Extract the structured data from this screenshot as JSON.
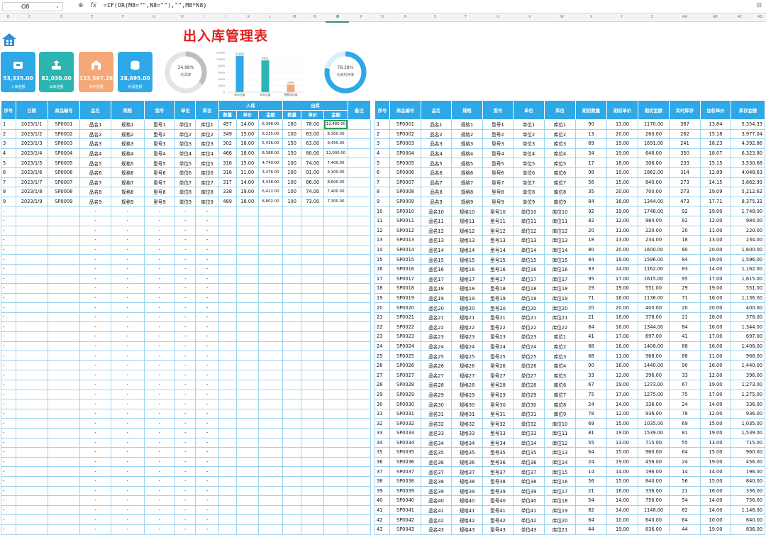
{
  "formula_bar": {
    "cell_ref": "O8",
    "formula": "=IF(OR(M8=\"\",N8=\"\"),\"\",M8*N8)",
    "fx_label": "fx"
  },
  "column_letters": [
    "B",
    "C",
    "D",
    "E",
    "F",
    "G",
    "H",
    "I",
    "J",
    "K",
    "L",
    "M",
    "N",
    "O",
    "P",
    "Q",
    "R",
    "S",
    "T",
    "U",
    "V",
    "W",
    "X",
    "Y",
    "Z",
    "AA",
    "AB",
    "AC",
    "AD"
  ],
  "selected_column": "O",
  "dashboard": {
    "title": "出入库管理表",
    "cards": [
      {
        "value": "53,335.00",
        "label": "入库金额",
        "color": "#2ea8e6",
        "icon": "inbox-icon"
      },
      {
        "value": "82,030.00",
        "label": "出库金额",
        "color": "#2bb5b0",
        "icon": "outbox-icon"
      },
      {
        "value": "133,597.26",
        "label": "库存金额",
        "color": "#f4a877",
        "icon": "warehouse-icon"
      },
      {
        "value": "28,695.00",
        "label": "利润金额",
        "color": "#2ea8e6",
        "icon": "coins-icon"
      }
    ],
    "donuts": [
      {
        "value": "34.98%",
        "label": "利润率",
        "fraction": 0.3498,
        "color": "#bdbdbd"
      },
      {
        "value": "78.28%",
        "label": "仓库利用率",
        "fraction": 0.7828,
        "color": "#2ea8e6"
      }
    ]
  },
  "chart_data": {
    "type": "bar",
    "categories": [
      "库存总量",
      "库存总量",
      "预警库存量"
    ],
    "values": [
      11000,
      9611,
      2309
    ],
    "data_labels": [
      "11000",
      "9611",
      "2309"
    ],
    "colors": [
      "#2ea8e6",
      "#2bb5b0",
      "#f4a877"
    ],
    "ylim": [
      0,
      12000
    ],
    "yticks": [
      "12000",
      "10000",
      "8000",
      "6000",
      "4000",
      "2000",
      "0"
    ]
  },
  "left_table": {
    "headers_top": [
      "序号",
      "日期",
      "商品编号",
      "品名",
      "规格",
      "型号",
      "单位",
      "库位",
      "入库",
      "出库",
      "备注"
    ],
    "headers_sub": [
      "数量",
      "单价",
      "金额",
      "数量",
      "单价",
      "金额"
    ],
    "rows": [
      [
        "1",
        "2023/1/1",
        "SP0001",
        "品名1",
        "规格1",
        "型号1",
        "单位1",
        "库位1",
        "457",
        "14.00",
        "6,398.00",
        "160",
        "78.00",
        "12,480.00",
        ""
      ],
      [
        "2",
        "2023/1/2",
        "SP0002",
        "品名2",
        "规格2",
        "型号2",
        "单位2",
        "库位2",
        "349",
        "15.00",
        "6,235.00",
        "100",
        "83.00",
        "8,300.00",
        ""
      ],
      [
        "3",
        "2023/1/3",
        "SP0003",
        "品名3",
        "规格3",
        "型号3",
        "单位3",
        "库位3",
        "302",
        "18.00",
        "5,436.00",
        "150",
        "63.00",
        "9,450.00",
        ""
      ],
      [
        "4",
        "2023/1/4",
        "SP0004",
        "品名4",
        "规格4",
        "型号4",
        "单位4",
        "库位4",
        "466",
        "18.00",
        "8,388.00",
        "150",
        "80.00",
        "12,000.00",
        ""
      ],
      [
        "5",
        "2023/1/5",
        "SP0005",
        "品名5",
        "规格5",
        "型号5",
        "单位5",
        "库位5",
        "316",
        "15.00",
        "4,740.00",
        "100",
        "74.00",
        "7,400.00",
        ""
      ],
      [
        "6",
        "2023/1/6",
        "SP0006",
        "品名6",
        "规格6",
        "型号6",
        "单位6",
        "库位6",
        "316",
        "11.00",
        "3,476.00",
        "100",
        "91.00",
        "9,100.00",
        ""
      ],
      [
        "7",
        "2023/1/7",
        "SP0007",
        "品名7",
        "规格7",
        "型号7",
        "单位7",
        "库位7",
        "317",
        "14.00",
        "4,438.00",
        "100",
        "86.00",
        "8,600.00",
        ""
      ],
      [
        "8",
        "2023/1/8",
        "SP0008",
        "品名8",
        "规格8",
        "型号8",
        "单位8",
        "库位8",
        "338",
        "19.00",
        "6,422.00",
        "100",
        "74.00",
        "7,400.00",
        ""
      ],
      [
        "9",
        "2023/1/9",
        "SP0009",
        "品名9",
        "规格9",
        "型号9",
        "单位9",
        "库位9",
        "489",
        "18.00",
        "8,802.00",
        "100",
        "73.00",
        "7,300.00",
        ""
      ]
    ],
    "empty_cell": "-"
  },
  "right_table": {
    "headers": [
      "序号",
      "商品编号",
      "品名",
      "规格",
      "型号",
      "单位",
      "库位",
      "期初数量",
      "期初单价",
      "期初金额",
      "实时库存",
      "加权单价",
      "库存金额"
    ],
    "rows": [
      [
        "1",
        "SP0001",
        "品名1",
        "规格1",
        "型号1",
        "单位1",
        "库位1",
        "90",
        "13.00",
        "1170.00",
        "387",
        "13.84",
        "5,354.33"
      ],
      [
        "2",
        "SP0002",
        "品名2",
        "规格2",
        "型号2",
        "单位2",
        "库位2",
        "13",
        "20.00",
        "260.00",
        "262",
        "15.18",
        "3,977.04"
      ],
      [
        "3",
        "SP0003",
        "品名3",
        "规格3",
        "型号3",
        "单位3",
        "库位3",
        "89",
        "19.00",
        "1691.00",
        "241",
        "18.23",
        "4,392.86"
      ],
      [
        "4",
        "SP0004",
        "品名4",
        "规格4",
        "型号4",
        "单位4",
        "库位4",
        "34",
        "19.00",
        "646.00",
        "350",
        "18.07",
        "6,323.80"
      ],
      [
        "5",
        "SP0005",
        "品名5",
        "规格5",
        "型号5",
        "单位5",
        "库位5",
        "17",
        "18.00",
        "306.00",
        "233",
        "15.15",
        "3,530.68"
      ],
      [
        "6",
        "SP0006",
        "品名6",
        "规格6",
        "型号6",
        "单位6",
        "库位6",
        "98",
        "19.00",
        "1862.00",
        "314",
        "12.89",
        "4,048.63"
      ],
      [
        "7",
        "SP0007",
        "品名7",
        "规格7",
        "型号7",
        "单位7",
        "库位7",
        "56",
        "15.00",
        "840.00",
        "273",
        "14.15",
        "3,862.99"
      ],
      [
        "8",
        "SP0008",
        "品名8",
        "规格8",
        "型号8",
        "单位8",
        "库位8",
        "35",
        "20.00",
        "700.00",
        "273",
        "19.09",
        "5,212.62"
      ],
      [
        "9",
        "SP0009",
        "品名9",
        "规格9",
        "型号9",
        "单位9",
        "库位9",
        "84",
        "16.00",
        "1344.00",
        "473",
        "17.71",
        "8,375.32"
      ],
      [
        "10",
        "SP0010",
        "品名10",
        "规格10",
        "型号10",
        "单位10",
        "库位10",
        "92",
        "19.00",
        "1748.00",
        "92",
        "19.00",
        "1,748.00"
      ],
      [
        "11",
        "SP0011",
        "品名11",
        "规格11",
        "型号11",
        "单位11",
        "库位11",
        "82",
        "12.00",
        "984.00",
        "82",
        "12.00",
        "984.00"
      ],
      [
        "12",
        "SP0012",
        "品名12",
        "规格12",
        "型号12",
        "单位12",
        "库位12",
        "20",
        "11.00",
        "220.00",
        "20",
        "11.00",
        "220.00"
      ],
      [
        "13",
        "SP0013",
        "品名13",
        "规格13",
        "型号13",
        "单位13",
        "库位13",
        "18",
        "13.00",
        "234.00",
        "18",
        "13.00",
        "234.00"
      ],
      [
        "14",
        "SP0014",
        "品名14",
        "规格14",
        "型号14",
        "单位14",
        "库位14",
        "80",
        "20.00",
        "1600.00",
        "80",
        "20.00",
        "1,600.00"
      ],
      [
        "15",
        "SP0015",
        "品名15",
        "规格15",
        "型号15",
        "单位15",
        "库位15",
        "84",
        "19.00",
        "1596.00",
        "84",
        "19.00",
        "1,596.00"
      ],
      [
        "16",
        "SP0016",
        "品名16",
        "规格16",
        "型号16",
        "单位16",
        "库位16",
        "83",
        "14.00",
        "1162.00",
        "83",
        "14.00",
        "1,162.00"
      ],
      [
        "17",
        "SP0017",
        "品名17",
        "规格17",
        "型号17",
        "单位17",
        "库位17",
        "95",
        "17.00",
        "1615.00",
        "95",
        "17.00",
        "1,615.00"
      ],
      [
        "18",
        "SP0018",
        "品名18",
        "规格18",
        "型号18",
        "单位18",
        "库位18",
        "29",
        "19.00",
        "551.00",
        "29",
        "19.00",
        "551.00"
      ],
      [
        "19",
        "SP0019",
        "品名19",
        "规格19",
        "型号19",
        "单位19",
        "库位19",
        "71",
        "16.00",
        "1136.00",
        "71",
        "16.00",
        "1,136.00"
      ],
      [
        "20",
        "SP0020",
        "品名20",
        "规格20",
        "型号20",
        "单位20",
        "库位20",
        "20",
        "20.00",
        "400.00",
        "20",
        "20.00",
        "400.00"
      ],
      [
        "21",
        "SP0021",
        "品名21",
        "规格21",
        "型号21",
        "单位21",
        "库位21",
        "21",
        "18.00",
        "378.00",
        "21",
        "18.00",
        "378.00"
      ],
      [
        "22",
        "SP0022",
        "品名22",
        "规格22",
        "型号22",
        "单位22",
        "库位22",
        "84",
        "16.00",
        "1344.00",
        "84",
        "16.00",
        "1,344.00"
      ],
      [
        "23",
        "SP0023",
        "品名23",
        "规格23",
        "型号23",
        "单位23",
        "库位1",
        "41",
        "17.00",
        "697.00",
        "41",
        "17.00",
        "697.00"
      ],
      [
        "24",
        "SP0024",
        "品名24",
        "规格24",
        "型号24",
        "单位24",
        "库位2",
        "88",
        "16.00",
        "1408.00",
        "88",
        "16.00",
        "1,408.00"
      ],
      [
        "25",
        "SP0025",
        "品名25",
        "规格25",
        "型号25",
        "单位25",
        "库位3",
        "88",
        "11.00",
        "968.00",
        "88",
        "11.00",
        "968.00"
      ],
      [
        "26",
        "SP0026",
        "品名26",
        "规格26",
        "型号26",
        "单位26",
        "库位4",
        "90",
        "16.00",
        "1440.00",
        "90",
        "16.00",
        "1,440.00"
      ],
      [
        "27",
        "SP0027",
        "品名27",
        "规格27",
        "型号27",
        "单位27",
        "库位5",
        "33",
        "12.00",
        "396.00",
        "33",
        "12.00",
        "396.00"
      ],
      [
        "28",
        "SP0028",
        "品名28",
        "规格28",
        "型号28",
        "单位28",
        "库位6",
        "67",
        "19.00",
        "1273.00",
        "67",
        "19.00",
        "1,273.00"
      ],
      [
        "29",
        "SP0029",
        "品名29",
        "规格29",
        "型号29",
        "单位29",
        "库位7",
        "75",
        "17.00",
        "1275.00",
        "75",
        "17.00",
        "1,275.00"
      ],
      [
        "30",
        "SP0030",
        "品名30",
        "规格30",
        "型号30",
        "单位30",
        "库位8",
        "24",
        "14.00",
        "336.00",
        "24",
        "14.00",
        "336.00"
      ],
      [
        "31",
        "SP0031",
        "品名31",
        "规格31",
        "型号31",
        "单位31",
        "库位9",
        "78",
        "12.00",
        "936.00",
        "78",
        "12.00",
        "936.00"
      ],
      [
        "32",
        "SP0032",
        "品名32",
        "规格32",
        "型号32",
        "单位32",
        "库位10",
        "69",
        "15.00",
        "1035.00",
        "69",
        "15.00",
        "1,035.00"
      ],
      [
        "33",
        "SP0033",
        "品名33",
        "规格33",
        "型号33",
        "单位33",
        "库位11",
        "81",
        "19.00",
        "1539.00",
        "81",
        "19.00",
        "1,539.00"
      ],
      [
        "34",
        "SP0034",
        "品名34",
        "规格34",
        "型号34",
        "单位34",
        "库位12",
        "55",
        "13.00",
        "715.00",
        "55",
        "13.00",
        "715.00"
      ],
      [
        "35",
        "SP0035",
        "品名35",
        "规格35",
        "型号35",
        "单位35",
        "库位13",
        "64",
        "15.00",
        "960.00",
        "64",
        "15.00",
        "960.00"
      ],
      [
        "36",
        "SP0036",
        "品名36",
        "规格36",
        "型号36",
        "单位36",
        "库位14",
        "24",
        "19.00",
        "456.00",
        "24",
        "19.00",
        "456.00"
      ],
      [
        "37",
        "SP0037",
        "品名37",
        "规格37",
        "型号37",
        "单位37",
        "库位15",
        "14",
        "14.00",
        "196.00",
        "14",
        "14.00",
        "196.00"
      ],
      [
        "38",
        "SP0038",
        "品名38",
        "规格38",
        "型号38",
        "单位38",
        "库位16",
        "56",
        "15.00",
        "840.00",
        "56",
        "15.00",
        "840.00"
      ],
      [
        "39",
        "SP0039",
        "品名39",
        "规格39",
        "型号39",
        "单位39",
        "库位17",
        "21",
        "16.00",
        "336.00",
        "21",
        "16.00",
        "336.00"
      ],
      [
        "40",
        "SP0040",
        "品名40",
        "规格40",
        "型号40",
        "单位40",
        "库位18",
        "54",
        "14.00",
        "756.00",
        "54",
        "14.00",
        "756.00"
      ],
      [
        "41",
        "SP0041",
        "品名41",
        "规格41",
        "型号41",
        "单位41",
        "库位19",
        "82",
        "14.00",
        "1148.00",
        "82",
        "14.00",
        "1,148.00"
      ],
      [
        "42",
        "SP0042",
        "品名42",
        "规格42",
        "型号42",
        "单位42",
        "库位20",
        "64",
        "10.00",
        "640.00",
        "64",
        "10.00",
        "640.00"
      ],
      [
        "43",
        "SP0043",
        "品名43",
        "规格43",
        "型号43",
        "单位43",
        "库位21",
        "44",
        "19.00",
        "836.00",
        "44",
        "19.00",
        "836.00"
      ]
    ]
  }
}
